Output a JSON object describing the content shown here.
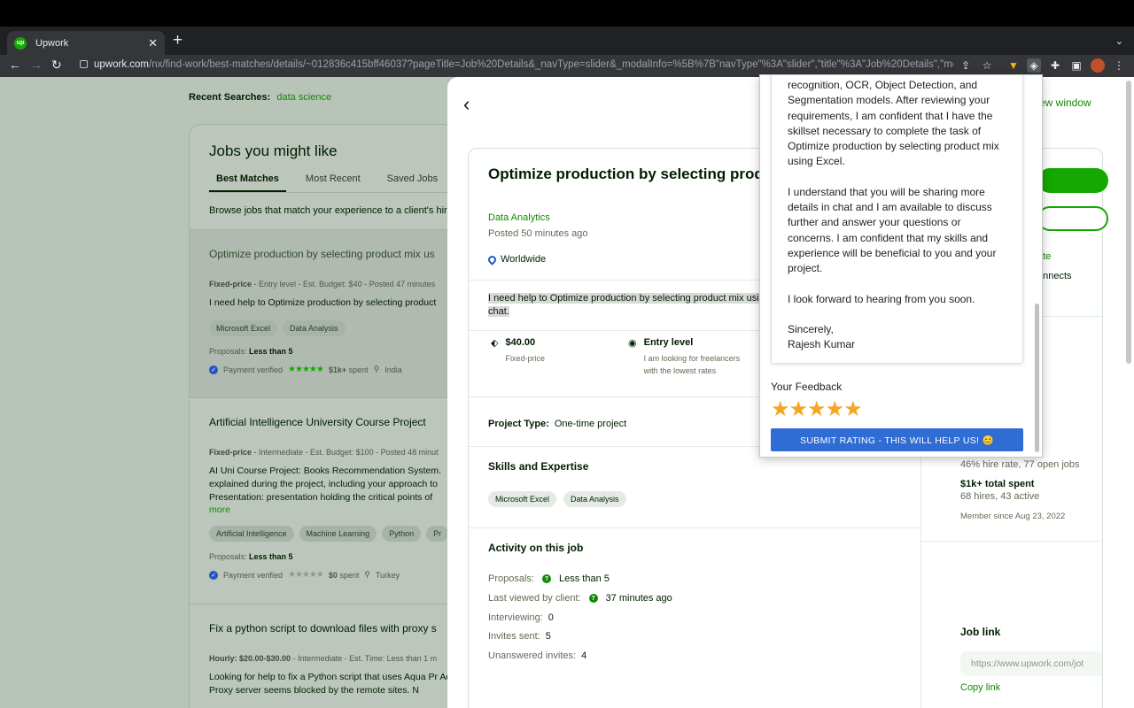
{
  "browser": {
    "tab_title": "Upwork",
    "favicon": "up",
    "url_host": "upwork.com",
    "url_path": "/nx/find-work/best-matches/details/~012836c415bff46037?pageTitle=Job%20Details&_navType=slider&_modalInfo=%5B%7B\"navType\"%3A\"slider\",\"title\"%3A\"Job%20Details\",\"mo..."
  },
  "left": {
    "recent_label": "Recent Searches:",
    "recent_value": "data science",
    "heading": "Jobs you might like",
    "tabs": [
      "Best Matches",
      "Most Recent",
      "Saved Jobs"
    ],
    "browse_text": "Browse jobs that match your experience to a client's hiri",
    "jobs": [
      {
        "title": "Optimize production by selecting product mix us",
        "meta_type": "Fixed-price",
        "meta_rest": " - Entry level - Est. Budget: $40 - Posted 47 minutes",
        "desc": "I need help to Optimize production by selecting product",
        "more": "",
        "tags": [
          "Microsoft Excel",
          "Data Analysis"
        ],
        "proposals_label": "Proposals:",
        "proposals_value": "Less than 5",
        "verified": "Payment verified",
        "spent_amount": "$1k+",
        "spent_label": "spent",
        "country": "India"
      },
      {
        "title": "Artificial Intelligence University Course Project",
        "meta_type": "Fixed-price",
        "meta_rest": " - Intermediate - Est. Budget: $100 - Posted 48 minut",
        "desc": "AI Uni Course Project: Books Recommendation System. explained during the project, including your approach to Presentation: presentation holding the critical points of",
        "more": "more",
        "tags": [
          "Artificial Intelligence",
          "Machine Learning",
          "Python",
          "Pr"
        ],
        "proposals_label": "Proposals:",
        "proposals_value": "Less than 5",
        "verified": "Payment verified",
        "spent_amount": "$0",
        "spent_label": "spent",
        "country": "Turkey"
      },
      {
        "title": "Fix a python script to download files with proxy s",
        "meta_type": "Hourly: $20.00-$30.00",
        "meta_rest": " - Intermediate - Est. Time: Less than 1 m",
        "desc": "Looking for help to fix a Python script that uses Aqua Pr Aqua Proxy server seems blocked by the remote sites. N"
      }
    ]
  },
  "slider": {
    "open_new_window": "ew window",
    "title": "Optimize production by selecting product",
    "category": "Data Analytics",
    "posted": "Posted 50 minutes ago",
    "location": "Worldwide",
    "description": "I need help to Optimize production by selecting product mix usi details in chat.",
    "price_value": "$40.00",
    "price_label": "Fixed-price",
    "level_value": "Entry level",
    "level_desc": "I am looking for freelancers with the lowest rates",
    "project_type_label": "Project Type:",
    "project_type_value": "One-time project",
    "skills_heading": "Skills and Expertise",
    "skills": [
      "Microsoft Excel",
      "Data Analysis"
    ],
    "activity_heading": "Activity on this job",
    "activity": [
      {
        "label": "Proposals:",
        "value": "Less than 5",
        "help": "?"
      },
      {
        "label": "Last viewed by client:",
        "value": "37 minutes ago",
        "help": "?"
      },
      {
        "label": "Interviewing:",
        "value": "0"
      },
      {
        "label": "Invites sent:",
        "value": "5"
      },
      {
        "label": "Unanswered invites:",
        "value": "4"
      }
    ],
    "flag_fragment": "ate",
    "connects_fragment": "onnects",
    "client": {
      "hire_rate": "46% hire rate, 77 open jobs",
      "total_spent": "$1k+ total spent",
      "hires": "68 hires, 43 active",
      "member_since": "Member since Aug 23, 2022"
    },
    "job_link_heading": "Job link",
    "job_link_value": "https://www.upwork.com/jot",
    "copy_link": "Copy link"
  },
  "popup": {
    "paragraphs": [
      "recognition, OCR, Object Detection, and Segmentation models. After reviewing your requirements, I am confident that I have the skillset necessary to complete the task of Optimize production by selecting product mix using Excel.",
      "I understand that you will be sharing more details in chat and I am available to discuss further and answer your questions or concerns. I am confident that my skills and experience will be beneficial to you and your project.",
      "I look forward to hearing from you soon.",
      "Sincerely,\nRajesh Kumar"
    ],
    "feedback_label": "Your Feedback",
    "stars": "★★★★★",
    "submit_label": "SUBMIT RATING - THIS WILL HELP US! 😊"
  },
  "colors": {
    "brand_green": "#14a800",
    "link_green": "#108a00",
    "star_gold": "#f4a622",
    "submit_blue": "#2f6cd4"
  }
}
